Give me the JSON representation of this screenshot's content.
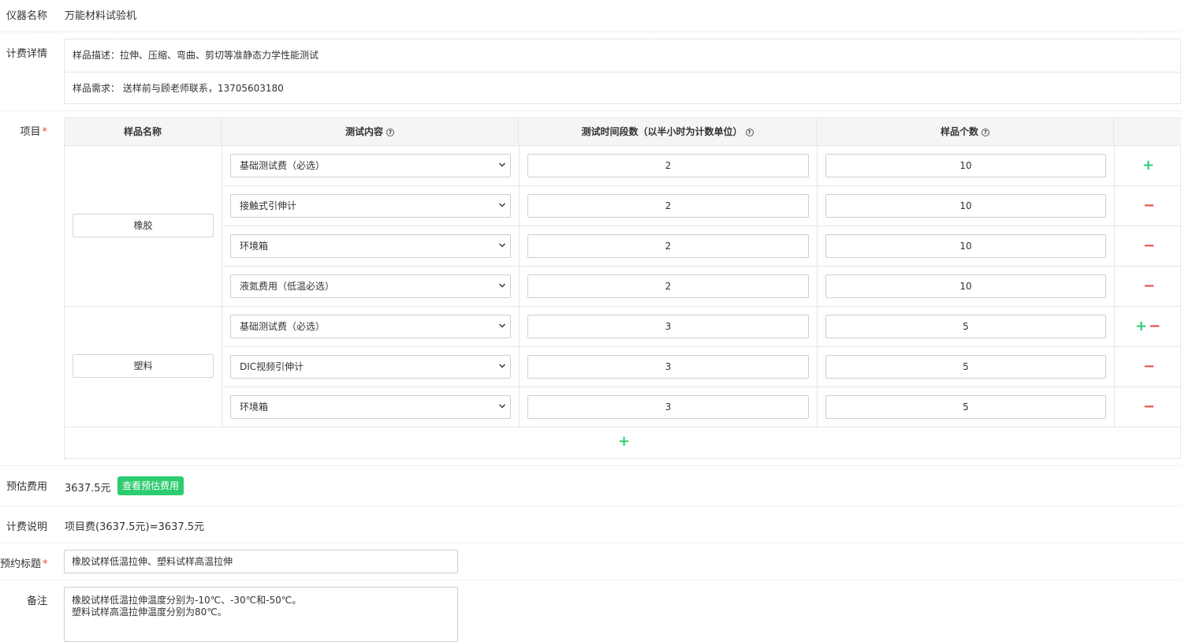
{
  "instrument": {
    "label": "仪器名称",
    "value": "万能材料试验机"
  },
  "billing_detail": {
    "label": "计费详情",
    "description": "样品描述：拉伸、压缩、弯曲、剪切等准静态力学性能测试",
    "requirement": "样品需求： 送样前与顾老师联系，13705603180"
  },
  "items": {
    "label": "项目",
    "required_mark": "*",
    "headers": {
      "sample_name": "样品名称",
      "test_content": "测试内容",
      "time_segments": "测试时间段数（以半小时为计数单位）",
      "sample_count": "样品个数",
      "help_glyph": "?"
    },
    "groups": [
      {
        "sample": "橡胶",
        "rows": [
          {
            "content": "基础测试费（必选）",
            "time": "2",
            "count": "10",
            "actions": "+"
          },
          {
            "content": "接触式引伸计",
            "time": "2",
            "count": "10",
            "actions": "−"
          },
          {
            "content": "环境箱",
            "time": "2",
            "count": "10",
            "actions": "−"
          },
          {
            "content": "液氮费用（低温必选）",
            "time": "2",
            "count": "10",
            "actions": "−"
          }
        ]
      },
      {
        "sample": "塑料",
        "rows": [
          {
            "content": "基础测试费（必选）",
            "time": "3",
            "count": "5",
            "actions": "+−"
          },
          {
            "content": "DIC视频引伸计",
            "time": "3",
            "count": "5",
            "actions": "−"
          },
          {
            "content": "环境箱",
            "time": "3",
            "count": "5",
            "actions": "−"
          }
        ]
      }
    ],
    "add_group": "+"
  },
  "estimate": {
    "label": "预估费用",
    "value": "3637.5元",
    "button": "查看预估费用"
  },
  "billing_note": {
    "label": "计费说明",
    "value": "项目费(3637.5元)=3637.5元"
  },
  "booking_title": {
    "label": "预约标题",
    "required_mark": "*",
    "value": "橡胶试样低温拉伸、塑料试样高温拉伸"
  },
  "remark": {
    "label": "备注",
    "line1": "橡胶试样低温拉伸温度分别为-10℃、-30℃和-50℃。",
    "line2": "塑料试样高温拉伸温度分别为80℃。"
  },
  "colors": {
    "accent_green": "#2ecc71",
    "danger_red": "#e74c3c",
    "border": "#e6e6e6"
  },
  "icons": {
    "select_arrow": "chevron-down-icon",
    "help": "question-circle-icon"
  }
}
